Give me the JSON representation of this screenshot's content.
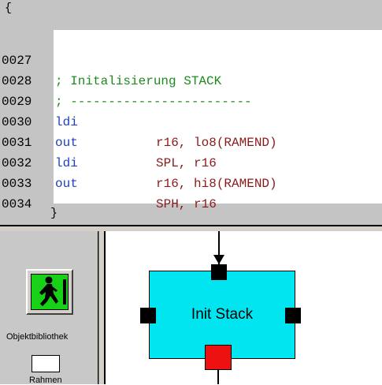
{
  "editor": {
    "open_brace": "{",
    "close_brace": "}",
    "lines": [
      {
        "num": "0027",
        "comment": "; Initalisierung STACK"
      },
      {
        "num": "0028",
        "comment": "; ------------------------"
      },
      {
        "num": "0029",
        "instr": "ldi",
        "args": "r16, lo8(RAMEND)"
      },
      {
        "num": "0030",
        "instr": "out",
        "args": "SPL, r16"
      },
      {
        "num": "0031",
        "instr": "ldi",
        "args": "r16, hi8(RAMEND)"
      },
      {
        "num": "0032",
        "instr": "out",
        "args": "SPH, r16"
      },
      {
        "num": "0033"
      },
      {
        "num": "0034"
      }
    ]
  },
  "palette": {
    "library_label": "Objektbibliothek",
    "frame_label": "Rahmen",
    "ampel_icon": "green-pedestrian-light-icon"
  },
  "diagram": {
    "block_label": "Init Stack",
    "colors": {
      "block": "#00e5ef",
      "out_port": "#ee1111",
      "port": "#000000"
    }
  }
}
